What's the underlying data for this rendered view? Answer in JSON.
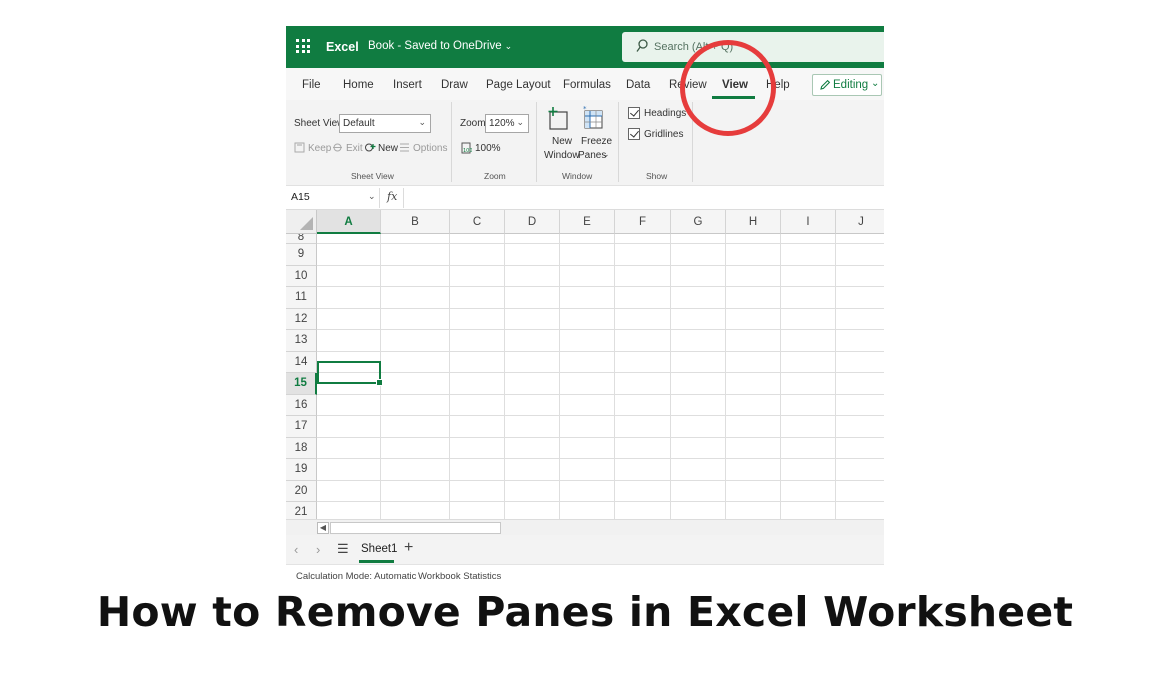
{
  "title_bar": {
    "app_name": "Excel",
    "doc_title": "Book - Saved to OneDrive",
    "doc_chevron": "⌄",
    "search_placeholder": "Search (Alt + Q)",
    "brand_color": "#107c41"
  },
  "menu": {
    "tabs": [
      "File",
      "Home",
      "Insert",
      "Draw",
      "Page Layout",
      "Formulas",
      "Data",
      "Review",
      "View",
      "Help"
    ],
    "active_tab": "View",
    "editing_label": "Editing"
  },
  "ribbon": {
    "sheet_view": {
      "label": "Sheet View",
      "selected": "Default",
      "keep": "Keep",
      "exit": "Exit",
      "new": "New",
      "options": "Options",
      "group_label": "Sheet View"
    },
    "zoom": {
      "label": "Zoom",
      "selected": "120%",
      "hundred": "100%",
      "group_label": "Zoom"
    },
    "window": {
      "new_window_line1": "New",
      "new_window_line2": "Window",
      "freeze_line1": "Freeze",
      "freeze_line2": "Panes",
      "group_label": "Window"
    },
    "show": {
      "headings": "Headings",
      "headings_checked": true,
      "gridlines": "Gridlines",
      "gridlines_checked": true,
      "group_label": "Show"
    }
  },
  "formula_bar": {
    "name_box": "A15",
    "fx": "fx",
    "value": ""
  },
  "grid": {
    "columns": [
      "A",
      "B",
      "C",
      "D",
      "E",
      "F",
      "G",
      "H",
      "I",
      "J"
    ],
    "rows": [
      "8",
      "9",
      "10",
      "11",
      "12",
      "13",
      "14",
      "15",
      "16",
      "17",
      "18",
      "19",
      "20",
      "21"
    ],
    "selected_column": "A",
    "selected_row": "15"
  },
  "sheets": {
    "tabs": [
      "Sheet1"
    ],
    "active": "Sheet1",
    "add": "+"
  },
  "status": {
    "calc_mode": "Calculation Mode: Automatic",
    "stats": "Workbook Statistics"
  },
  "annotation": {
    "circle_color": "#e63c3c"
  },
  "caption": "How to Remove Panes in Excel Worksheet"
}
